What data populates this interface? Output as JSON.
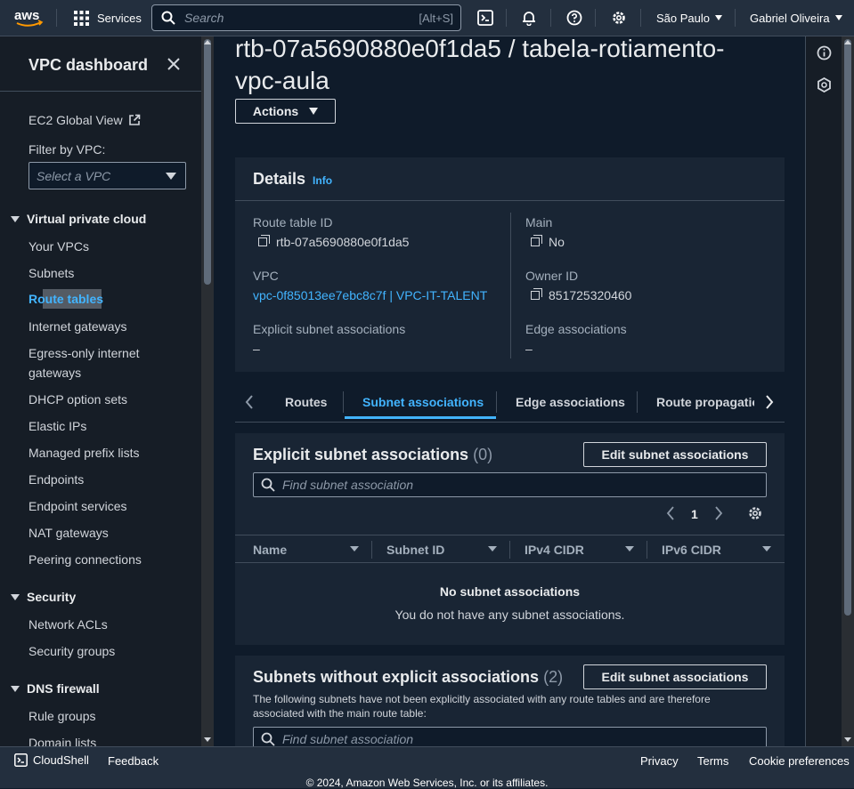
{
  "topbar": {
    "logo": "aws",
    "services_label": "Services",
    "search_placeholder": "Search",
    "search_shortcut": "[Alt+S]",
    "region": "São Paulo",
    "user": "Gabriel Oliveira"
  },
  "sidebar": {
    "title": "VPC dashboard",
    "ec2_global_view": "EC2 Global View",
    "filter_label": "Filter by VPC:",
    "filter_placeholder": "Select a VPC",
    "sections": [
      {
        "title": "Virtual private cloud",
        "items": [
          "Your VPCs",
          "Subnets",
          "Route tables",
          "Internet gateways",
          "Egress-only internet gateways",
          "DHCP option sets",
          "Elastic IPs",
          "Managed prefix lists",
          "Endpoints",
          "Endpoint services",
          "NAT gateways",
          "Peering connections"
        ]
      },
      {
        "title": "Security",
        "items": [
          "Network ACLs",
          "Security groups"
        ]
      },
      {
        "title": "DNS firewall",
        "items": [
          "Rule groups",
          "Domain lists"
        ]
      }
    ],
    "active_item": "Route tables"
  },
  "page": {
    "title": "rtb-07a5690880e0f1da5 / tabela-rotiamento-vpc-aula",
    "actions_label": "Actions"
  },
  "details": {
    "heading": "Details",
    "info": "Info",
    "route_table_id_label": "Route table ID",
    "route_table_id": "rtb-07a5690880e0f1da5",
    "main_label": "Main",
    "main_value": "No",
    "vpc_label": "VPC",
    "vpc_value": "vpc-0f85013ee7ebc8c7f | VPC-IT-TALENT",
    "owner_label": "Owner ID",
    "owner_value": "851725320460",
    "explicit_label": "Explicit subnet associations",
    "explicit_value": "–",
    "edge_label": "Edge associations",
    "edge_value": "–"
  },
  "tabs": [
    "Routes",
    "Subnet associations",
    "Edge associations",
    "Route propagation"
  ],
  "active_tab": "Subnet associations",
  "explicit": {
    "heading": "Explicit subnet associations",
    "count": "(0)",
    "edit_label": "Edit subnet associations",
    "find_placeholder": "Find subnet association",
    "page": "1",
    "columns": [
      "Name",
      "Subnet ID",
      "IPv4 CIDR",
      "IPv6 CIDR"
    ],
    "empty_title": "No subnet associations",
    "empty_text": "You do not have any subnet associations."
  },
  "without": {
    "heading": "Subnets without explicit associations",
    "count": "(2)",
    "edit_label": "Edit subnet associations",
    "description": "The following subnets have not been explicitly associated with any route tables and are therefore associated with the main route table:",
    "find_placeholder": "Find subnet association"
  },
  "footer": {
    "cloudshell": "CloudShell",
    "feedback": "Feedback",
    "privacy": "Privacy",
    "terms": "Terms",
    "cookies": "Cookie preferences",
    "copyright": "© 2024, Amazon Web Services, Inc. or its affiliates."
  },
  "colors": {
    "link": "#42b4ff",
    "topbar": "#232f3e",
    "page_bg": "#0f1b2a",
    "panel": "#192534"
  }
}
